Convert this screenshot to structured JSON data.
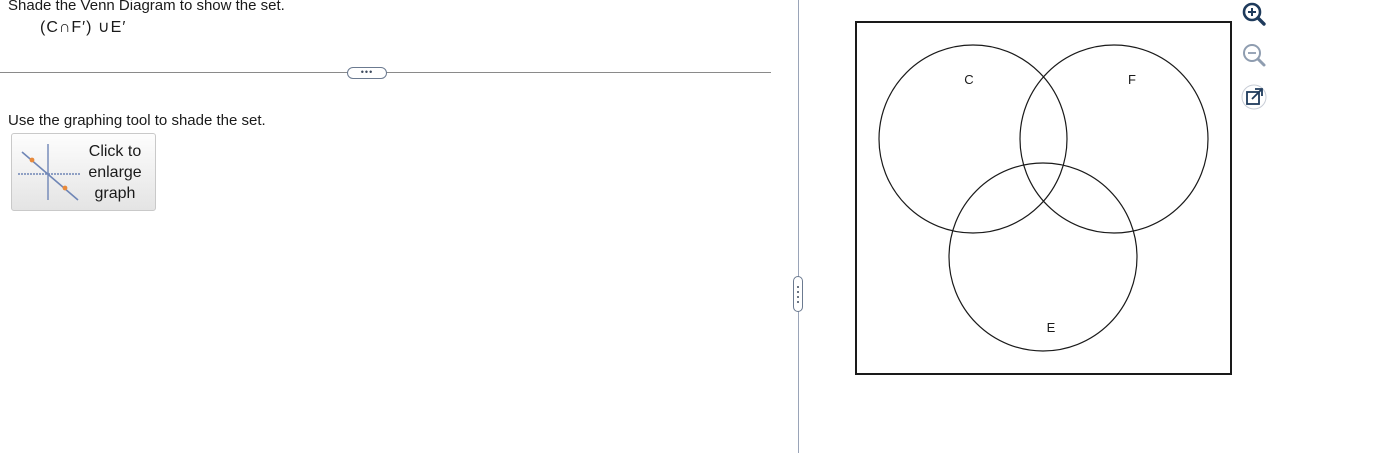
{
  "question": {
    "instruction": "Shade the Venn Diagram to show the set.",
    "set_expression": "(C∩F′) ∪E′"
  },
  "splitter": {
    "horizontal_handle_glyph": "•••"
  },
  "graphing": {
    "instruction": "Use the graphing tool to shade the set.",
    "enlarge_button_label": "Click to\nenlarge\ngraph",
    "thumbnail_icon": "graph-thumbnail-icon"
  },
  "venn": {
    "sets": [
      "C",
      "F",
      "E"
    ],
    "labels": {
      "c": "C",
      "f": "F",
      "e": "E"
    }
  },
  "toolbar": {
    "icons": [
      "zoom-in-icon",
      "zoom-out-icon",
      "popout-icon"
    ],
    "accent_color": "#1f3b5c"
  }
}
